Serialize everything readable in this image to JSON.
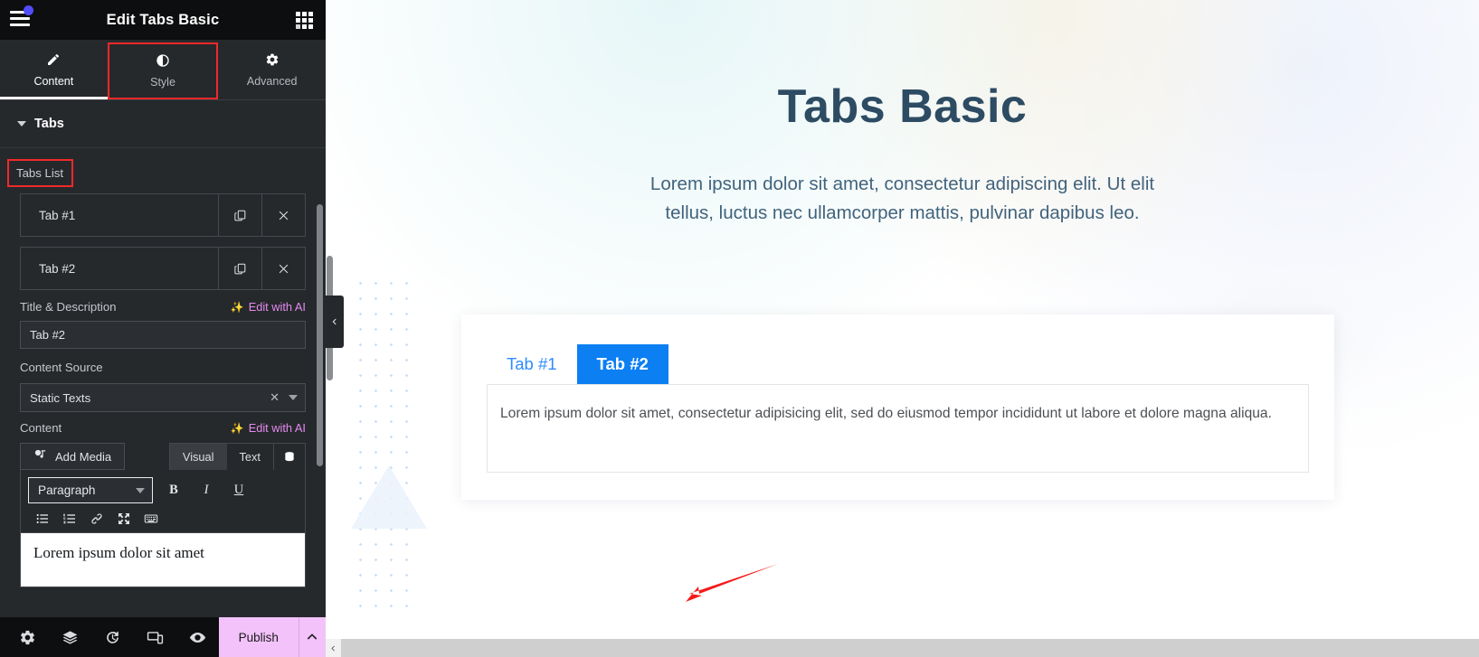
{
  "sidebar": {
    "header": {
      "title": "Edit Tabs Basic",
      "menu_icon": "hamburger-menu-icon",
      "widgets_icon": "widgets-grid-icon"
    },
    "tabs": [
      {
        "label": "Content",
        "icon": "pencil-icon",
        "active": true,
        "highlighted": false
      },
      {
        "label": "Style",
        "icon": "contrast-half-circle-icon",
        "active": false,
        "highlighted": true
      },
      {
        "label": "Advanced",
        "icon": "gear-icon",
        "active": false,
        "highlighted": false
      }
    ],
    "section": {
      "title": "Tabs",
      "collapse_icon": "caret-down-icon"
    },
    "tabs_list": {
      "label": "Tabs List",
      "items": [
        {
          "title": "Tab #1",
          "duplicate_icon": "copy-icon",
          "remove_icon": "close-x-icon"
        },
        {
          "title": "Tab #2",
          "duplicate_icon": "copy-icon",
          "remove_icon": "close-x-icon"
        }
      ]
    },
    "title_description": {
      "label": "Title & Description",
      "ai_label": "Edit with AI",
      "ai_icon": "ai-sparkle-icon",
      "input_value": "Tab #2",
      "input_placeholder": "Tab #2"
    },
    "content_source": {
      "label": "Content Source",
      "selected": "Static Texts",
      "clear_icon": "clear-x-icon",
      "arrow_icon": "caret-down-icon",
      "options": [
        "Static Texts"
      ]
    },
    "content": {
      "label": "Content",
      "ai_label": "Edit with AI",
      "ai_icon": "ai-sparkle-icon",
      "add_media_label": "Add Media",
      "add_media_icon": "media-icon",
      "modes": [
        {
          "label": "Visual",
          "selected": true
        },
        {
          "label": "Text",
          "selected": false
        }
      ],
      "db_icon": "database-icon",
      "toolbar": {
        "format_select": "Paragraph",
        "bold": "B",
        "italic": "I",
        "underline": "U",
        "icons": [
          "bulleted-list-icon",
          "numbered-list-icon",
          "link-icon",
          "fullscreen-icon",
          "keyboard-shortcuts-icon"
        ]
      },
      "editor_text": "Lorem ipsum dolor sit amet"
    },
    "footer": {
      "icons": [
        "settings-gear-icon",
        "navigator-layers-icon",
        "history-revisions-icon",
        "responsive-mode-icon",
        "preview-eye-icon"
      ],
      "publish_label": "Publish",
      "publish_caret_icon": "chevron-up-icon"
    },
    "scrollbar": "sidebar-vertical-scrollbar"
  },
  "canvas": {
    "page_title": "Tabs Basic",
    "intro_text": "Lorem ipsum dolor sit amet, consectetur adipiscing elit. Ut elit tellus, luctus nec ullamcorper mattis, pulvinar dapibus leo.",
    "widget": {
      "tabs": [
        {
          "label": "Tab #1",
          "active": false
        },
        {
          "label": "Tab #2",
          "active": true
        }
      ],
      "panel_text": "Lorem ipsum dolor sit amet, consectetur adipisicing elit, sed do eiusmod tempor incididunt ut labore et dolore magna aliqua."
    },
    "collapse_handle_icon": "chevron-left-icon",
    "hscroll_left_icon": "chevron-left-icon",
    "annotation_arrow": "red-arrow-pointing-left"
  },
  "colors": {
    "sidebar_bg": "#26292c",
    "header_bg": "#0d0e0f",
    "accent_blue": "#0c7ff2",
    "tab_link_blue": "#2f8bff",
    "heading_slate": "#2d4c63",
    "ai_pink": "#e48af0",
    "publish_pink": "#f3c2fb",
    "highlight_red": "#f02929",
    "badge_purple": "#524cff"
  }
}
